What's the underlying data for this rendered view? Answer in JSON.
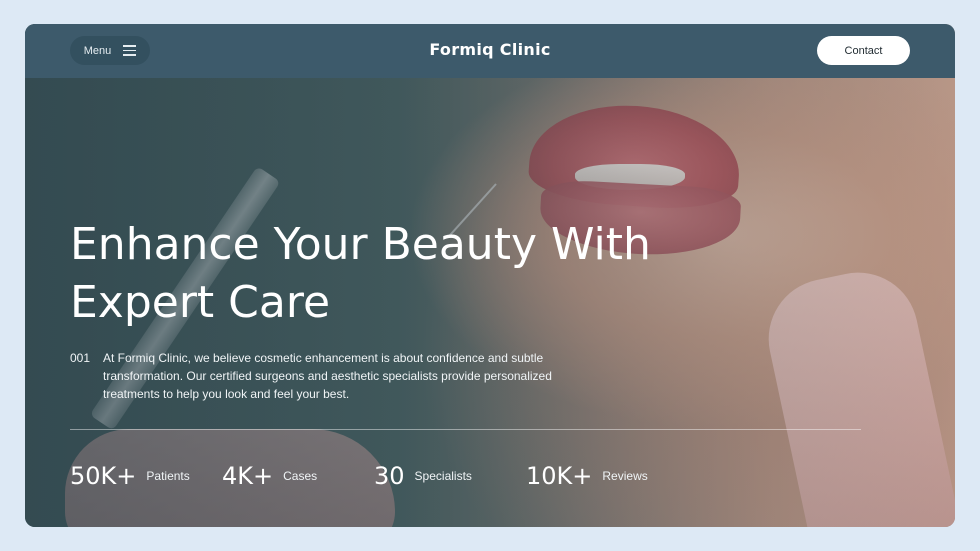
{
  "header": {
    "menu_label": "Menu",
    "brand": "Formiq Clinic",
    "contact_label": "Contact"
  },
  "hero": {
    "headline_line1": "Enhance Your Beauty With",
    "headline_line2": "Expert Care",
    "intro_number": "001",
    "intro_text": "At Formiq Clinic, we believe cosmetic enhancement is about confidence and subtle transformation. Our certified surgeons and aesthetic specialists provide personalized treatments to help you look and feel your best."
  },
  "stats": [
    {
      "value": "50K+",
      "label": "Patients"
    },
    {
      "value": "4K+",
      "label": "Cases"
    },
    {
      "value": "30",
      "label": "Specialists"
    },
    {
      "value": "10K+",
      "label": "Reviews"
    }
  ],
  "colors": {
    "page_bg": "#dde9f5",
    "header_bg": "#3d5a6b",
    "contact_bg": "#ffffff",
    "text_light": "#ffffff"
  },
  "icons": {
    "menu": "hamburger-icon"
  }
}
